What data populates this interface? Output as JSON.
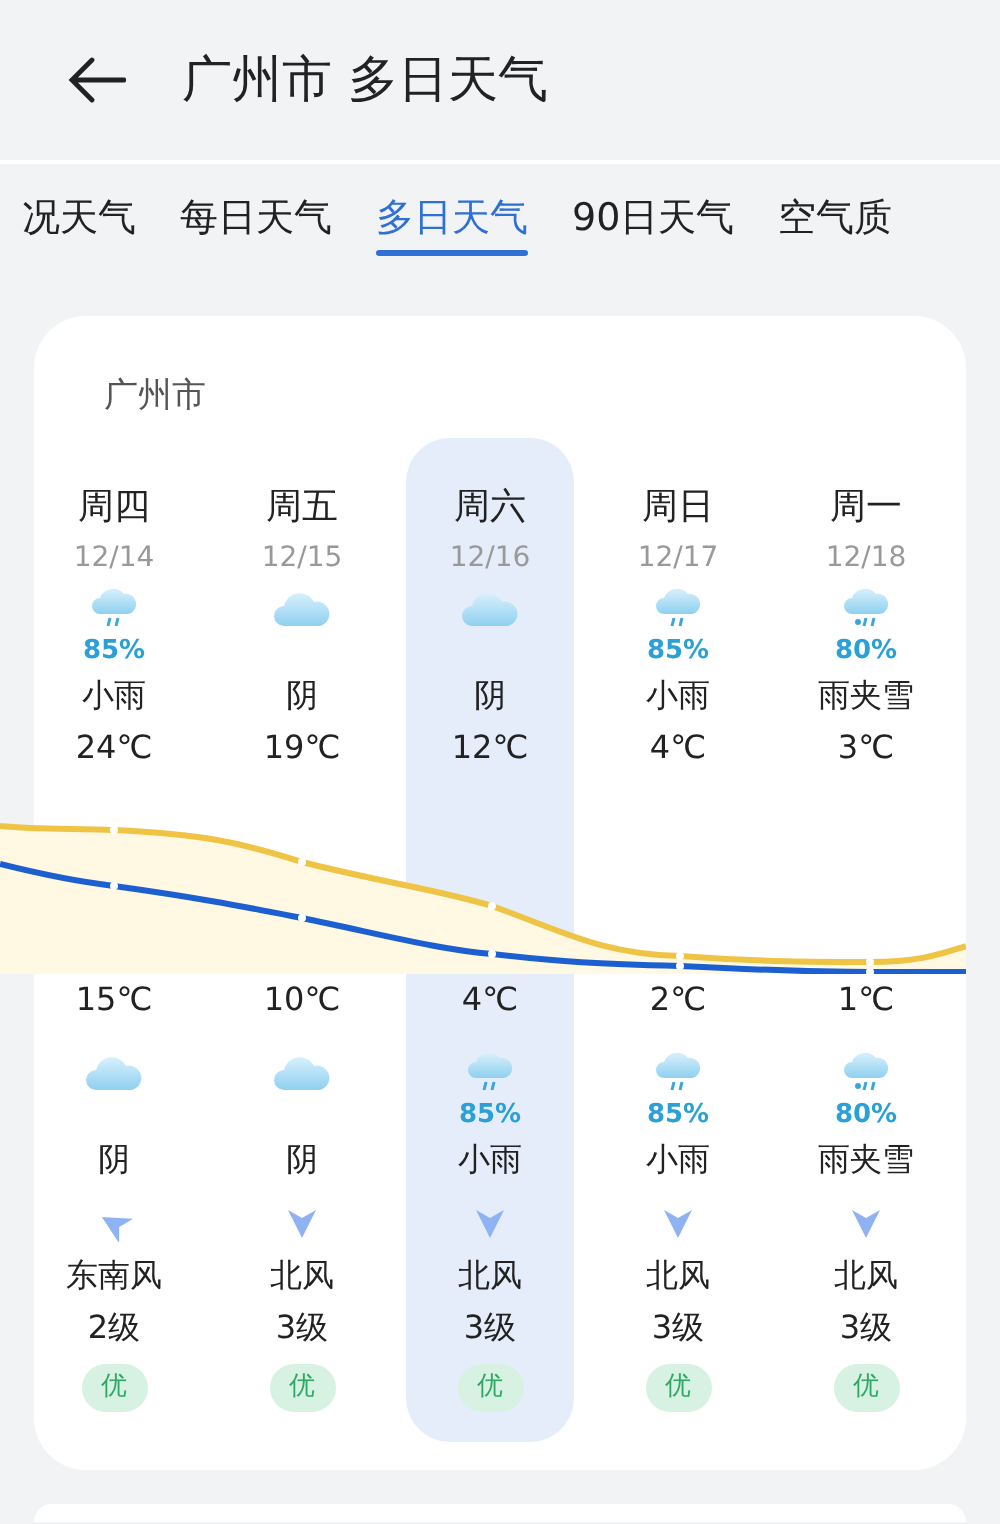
{
  "header": {
    "title": "广州市 多日天气"
  },
  "tabs": [
    {
      "label": "况天气",
      "selected": false
    },
    {
      "label": "每日天气",
      "selected": false
    },
    {
      "label": "多日天气",
      "selected": true
    },
    {
      "label": "90日天气",
      "selected": false
    },
    {
      "label": "空气质",
      "selected": false
    }
  ],
  "forecast": {
    "city": "广州市",
    "days": [
      {
        "day": "周四",
        "date": "12/14",
        "selected": false,
        "day_icon": {
          "kind": "rain"
        },
        "day_precip": "85%",
        "day_weather": "小雨",
        "high": "24℃",
        "low": "15℃",
        "night_icon": {
          "kind": "cloudy"
        },
        "night_weather": "阴",
        "wind_arrow": {
          "kind": "southeast"
        },
        "wind": "东南风",
        "wind_level": "2级",
        "aqi": "优"
      },
      {
        "day": "周五",
        "date": "12/15",
        "selected": false,
        "day_icon": {
          "kind": "cloudy"
        },
        "day_weather": "阴",
        "high": "19℃",
        "low": "10℃",
        "night_icon": {
          "kind": "cloudy"
        },
        "night_weather": "阴",
        "wind_arrow": {
          "kind": "north"
        },
        "wind": "北风",
        "wind_level": "3级",
        "aqi": "优"
      },
      {
        "day": "周六",
        "date": "12/16",
        "selected": true,
        "day_icon": {
          "kind": "cloudy"
        },
        "day_weather": "阴",
        "high": "12℃",
        "low": "4℃",
        "night_icon": {
          "kind": "rain"
        },
        "night_precip": "85%",
        "night_weather": "小雨",
        "wind_arrow": {
          "kind": "north"
        },
        "wind": "北风",
        "wind_level": "3级",
        "aqi": "优"
      },
      {
        "day": "周日",
        "date": "12/17",
        "selected": false,
        "day_icon": {
          "kind": "rain"
        },
        "day_precip": "85%",
        "day_weather": "小雨",
        "high": "4℃",
        "low": "2℃",
        "night_icon": {
          "kind": "rain"
        },
        "night_precip": "85%",
        "night_weather": "小雨",
        "wind_arrow": {
          "kind": "north"
        },
        "wind": "北风",
        "wind_level": "3级",
        "aqi": "优"
      },
      {
        "day": "周一",
        "date": "12/18",
        "selected": false,
        "day_icon": {
          "kind": "sleet"
        },
        "day_precip": "80%",
        "day_weather": "雨夹雪",
        "high": "3℃",
        "low": "1℃",
        "night_icon": {
          "kind": "sleet"
        },
        "night_precip": "80%",
        "night_weather": "雨夹雪",
        "wind_arrow": {
          "kind": "north"
        },
        "wind": "北风",
        "wind_level": "3级",
        "aqi": "优"
      }
    ]
  }
}
